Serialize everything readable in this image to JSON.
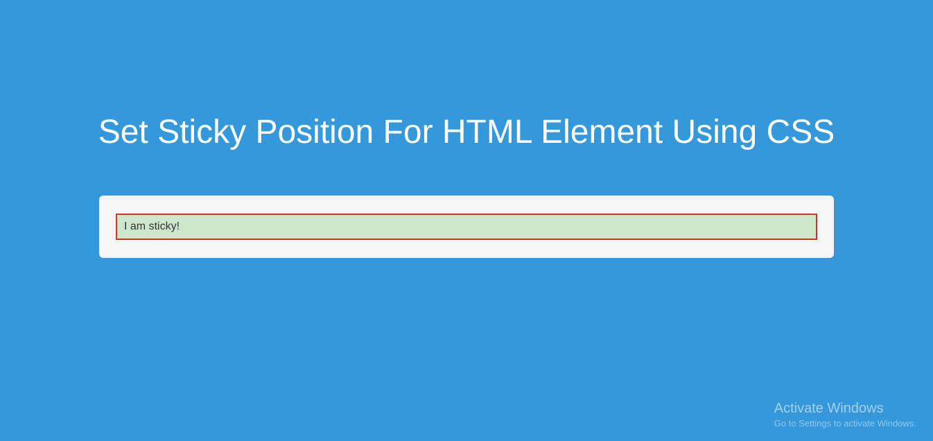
{
  "heading": "Set Sticky Position For HTML Element Using CSS",
  "sticky_text": "I am sticky!",
  "watermark": {
    "title": "Activate Windows",
    "subtitle": "Go to Settings to activate Windows."
  }
}
